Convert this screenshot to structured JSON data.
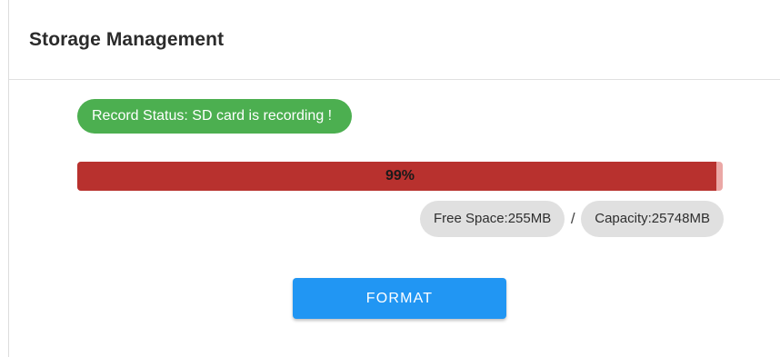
{
  "header": {
    "title": "Storage Management"
  },
  "status": {
    "text": "Record Status: SD card is recording !",
    "color": "#4caf50"
  },
  "usage": {
    "percent": 99,
    "label": "99%",
    "fill_color": "#b8312e",
    "track_color": "#eba8a6"
  },
  "storage": {
    "free_space": "Free Space:255MB",
    "separator": "/",
    "capacity": "Capacity:25748MB"
  },
  "actions": {
    "format_label": "FORMAT",
    "format_color": "#2196f3"
  }
}
